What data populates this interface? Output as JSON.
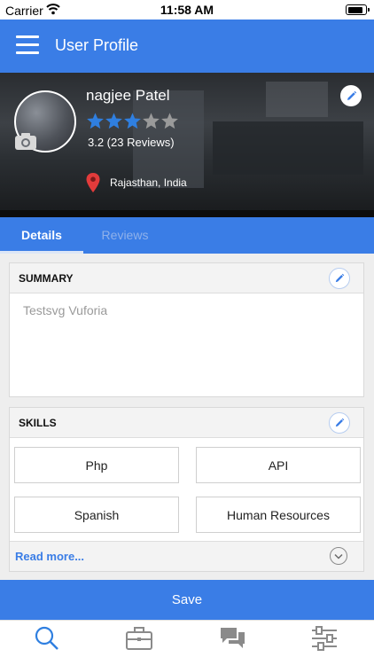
{
  "status_bar": {
    "carrier": "Carrier",
    "time": "11:58 AM",
    "battery_level": 0.9
  },
  "app_bar": {
    "title": "User Profile",
    "menu_icon": "hamburger-menu-icon"
  },
  "profile": {
    "name": "nagjee Patel",
    "rating": 3.2,
    "stars_total": 5,
    "stars_filled": 3,
    "rating_text": "3.2 (23 Reviews)",
    "location": "Rajasthan, India",
    "star_filled_color": "#2f7fe0",
    "star_empty_color": "#9a9a9a"
  },
  "tabs": [
    {
      "label": "Details",
      "active": true
    },
    {
      "label": "Reviews",
      "active": false
    }
  ],
  "summary": {
    "title": "SUMMARY",
    "text": "Testsvg Vuforia"
  },
  "skills": {
    "title": "SKILLS",
    "items": [
      "Php",
      "API",
      "Spanish",
      "Human Resources"
    ],
    "read_more": "Read more..."
  },
  "save_label": "Save",
  "bottom_nav": [
    {
      "icon": "search-icon",
      "active": true
    },
    {
      "icon": "briefcase-icon",
      "active": false
    },
    {
      "icon": "chat-icon",
      "active": false
    },
    {
      "icon": "settings-sliders-icon",
      "active": false
    }
  ],
  "colors": {
    "primary": "#3a7de6",
    "active_icon": "#2f7fe0",
    "inactive_icon": "#8a8a8a"
  }
}
